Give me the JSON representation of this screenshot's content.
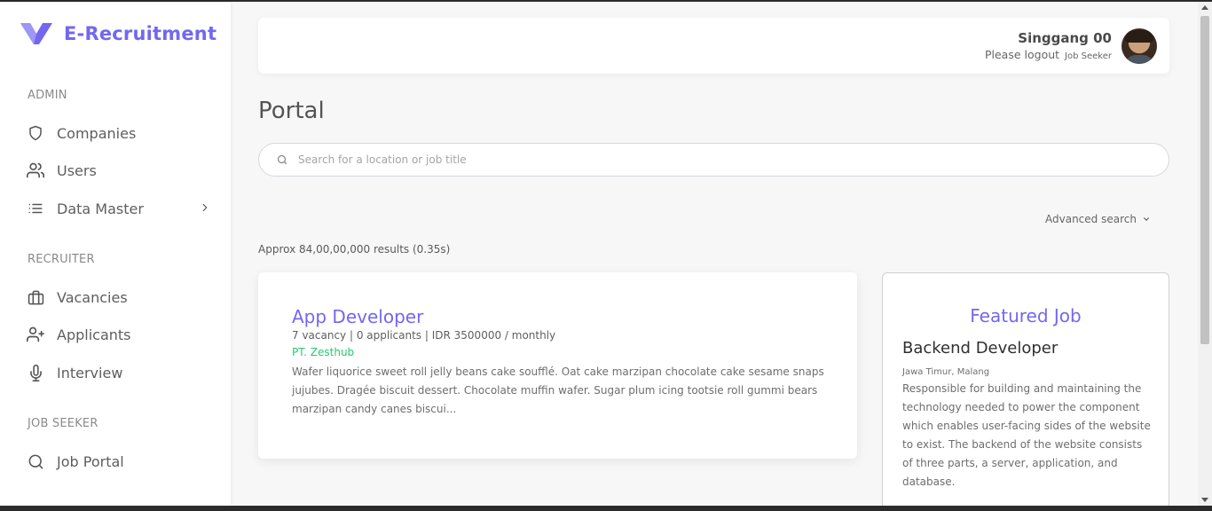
{
  "brand": {
    "name": "E-Recruitment",
    "color": "#7367f0"
  },
  "sidebar": {
    "sections": [
      {
        "title": "ADMIN"
      },
      {
        "title": "RECRUITER"
      },
      {
        "title": "JOB SEEKER"
      }
    ],
    "items": [
      {
        "label": "Companies",
        "icon": "shield-icon"
      },
      {
        "label": "Users",
        "icon": "users-icon"
      },
      {
        "label": "Data Master",
        "icon": "list-icon"
      },
      {
        "label": "Vacancies",
        "icon": "briefcase-icon"
      },
      {
        "label": "Applicants",
        "icon": "user-plus-icon"
      },
      {
        "label": "Interview",
        "icon": "microphone-icon"
      },
      {
        "label": "Job Portal",
        "icon": "search-icon"
      }
    ]
  },
  "header": {
    "user_name": "Singgang 00",
    "user_sub": "Please logout",
    "user_role": "Job Seeker"
  },
  "main": {
    "title": "Portal",
    "search_placeholder": "Search for a location or job title",
    "advanced_search": "Advanced search",
    "results": "Approx 84,00,00,000 results (0.35s)"
  },
  "job": {
    "title": "App Developer",
    "meta": "7 vacancy |  0 applicants |  IDR 3500000 / monthly",
    "company": "PT. Zesthub",
    "description": "Wafer liquorice sweet roll jelly beans cake soufflé. Oat cake marzipan chocolate cake sesame snaps jujubes. Dragée biscuit dessert. Chocolate muffin wafer. Sugar plum icing tootsie roll gummi bears marzipan candy canes biscui..."
  },
  "featured": {
    "heading": "Featured Job",
    "title": "Backend Developer",
    "location": "Jawa Timur, Malang",
    "description": "Responsible for building and maintaining the technology needed to power the component which enables user-facing sides of the website to exist. The backend of the website consists of three parts, a server, application, and database."
  },
  "colors": {
    "accent": "#7367f0",
    "success": "#28c76f"
  }
}
